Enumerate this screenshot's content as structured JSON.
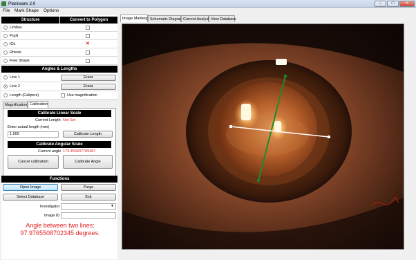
{
  "window": {
    "title": "Planiware 2.0",
    "minimize": "–",
    "maximize": "□",
    "close": "✕"
  },
  "menu": [
    "File",
    "Mark Shape",
    "Options"
  ],
  "structures": {
    "col_structure": "Structure",
    "col_convert": "Convert to Polygon",
    "items": [
      {
        "label": "Limbus",
        "converted": false
      },
      {
        "label": "Pupil",
        "converted": false
      },
      {
        "label": "IOL",
        "converted": true
      },
      {
        "label": "Rhexis",
        "converted": false
      },
      {
        "label": "Free Shape",
        "converted": false
      }
    ],
    "converted_mark": "✕"
  },
  "angles": {
    "header": "Angles & Lengths",
    "line1": "Line 1",
    "line2": "Line 2",
    "length": "Length (Calipers)",
    "erase": "Erase",
    "use_magnification": "Use magnification",
    "selected": "Line 2"
  },
  "tabs": [
    "Magnification",
    "Calibration"
  ],
  "active_tab": "Calibration",
  "calibration": {
    "linear_header": "Calibrate Linear Scale",
    "current_length_label": "Current Length",
    "current_length_value": "Not Set",
    "enter_length_label": "Enter actual length (mm)",
    "length_input": "1.000",
    "calibrate_length_button": "Calibrate Length",
    "angular_header": "Calibrate Angular Scale",
    "current_angle_label": "Current angle",
    "current_angle_value": "173.455837709487",
    "cancel_button": "Cancel calibration",
    "calibrate_angle_button": "Calibrate Angle"
  },
  "functions": {
    "header": "Functions",
    "open_image": "Open Image",
    "purge": "Purge",
    "select_database": "Select Database",
    "exit": "Exit",
    "investigator_label": "Investigator",
    "investigator_value": "",
    "image_id_label": "Image ID",
    "image_id_value": ""
  },
  "result": {
    "line1": "Angle between two lines:",
    "line2": "97.9765508702345 degrees."
  },
  "right_tabs": [
    "Image Marking",
    "Schematic Diagram",
    "Current Analysis",
    "View Database"
  ],
  "active_right_tab": "Image Marking",
  "colors": {
    "accent_red": "#e32020",
    "line_green": "#1d8a2a",
    "line_white": "#ffffff"
  }
}
